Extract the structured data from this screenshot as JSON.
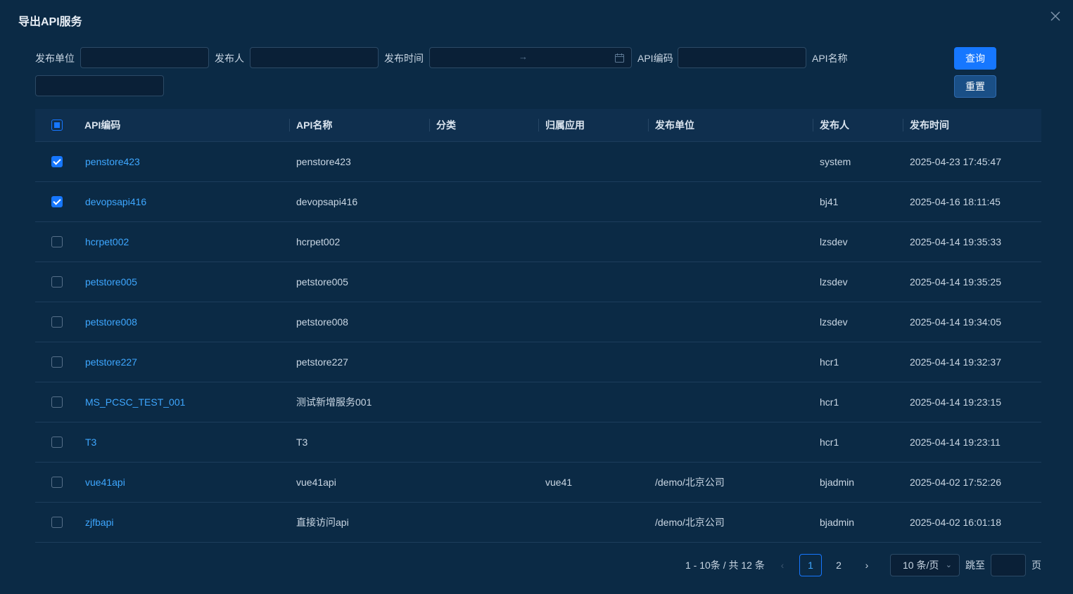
{
  "dialog": {
    "title": "导出API服务"
  },
  "filters": {
    "publish_unit_label": "发布单位",
    "publisher_label": "发布人",
    "publish_time_label": "发布时间",
    "date_separator": "→",
    "api_code_label": "API编码",
    "api_name_label": "API名称",
    "publish_unit_value": "",
    "publisher_value": "",
    "api_code_value": "",
    "api_name_value": "",
    "query_button": "查询",
    "reset_button": "重置"
  },
  "table": {
    "columns": [
      "API编码",
      "API名称",
      "分类",
      "归属应用",
      "发布单位",
      "发布人",
      "发布时间"
    ],
    "rows": [
      {
        "checked": true,
        "code": "penstore423",
        "name": "penstore423",
        "category": "",
        "app": "",
        "unit": "",
        "publisher": "system",
        "time": "2025-04-23 17:45:47"
      },
      {
        "checked": true,
        "code": "devopsapi416",
        "name": "devopsapi416",
        "category": "",
        "app": "",
        "unit": "",
        "publisher": "bj41",
        "time": "2025-04-16 18:11:45"
      },
      {
        "checked": false,
        "code": "hcrpet002",
        "name": "hcrpet002",
        "category": "",
        "app": "",
        "unit": "",
        "publisher": "lzsdev",
        "time": "2025-04-14 19:35:33"
      },
      {
        "checked": false,
        "code": "petstore005",
        "name": "petstore005",
        "category": "",
        "app": "",
        "unit": "",
        "publisher": "lzsdev",
        "time": "2025-04-14 19:35:25"
      },
      {
        "checked": false,
        "code": "petstore008",
        "name": "petstore008",
        "category": "",
        "app": "",
        "unit": "",
        "publisher": "lzsdev",
        "time": "2025-04-14 19:34:05"
      },
      {
        "checked": false,
        "code": "petstore227",
        "name": "petstore227",
        "category": "",
        "app": "",
        "unit": "",
        "publisher": "hcr1",
        "time": "2025-04-14 19:32:37"
      },
      {
        "checked": false,
        "code": "MS_PCSC_TEST_001",
        "name": "测试新增服务001",
        "category": "",
        "app": "",
        "unit": "",
        "publisher": "hcr1",
        "time": "2025-04-14 19:23:15"
      },
      {
        "checked": false,
        "code": "T3",
        "name": "T3",
        "category": "",
        "app": "",
        "unit": "",
        "publisher": "hcr1",
        "time": "2025-04-14 19:23:11"
      },
      {
        "checked": false,
        "code": "vue41api",
        "name": "vue41api",
        "category": "",
        "app": "vue41",
        "unit": "/demo/北京公司",
        "publisher": "bjadmin",
        "time": "2025-04-02 17:52:26"
      },
      {
        "checked": false,
        "code": "zjfbapi",
        "name": "直接访问api",
        "category": "",
        "app": "",
        "unit": "/demo/北京公司",
        "publisher": "bjadmin",
        "time": "2025-04-02 16:01:18"
      }
    ]
  },
  "pagination": {
    "total_text": "1 - 10条 / 共 12 条",
    "pages": [
      "1",
      "2"
    ],
    "current_page": "1",
    "page_size": "10 条/页",
    "jump_label": "跳至",
    "page_label": "页",
    "jump_value": ""
  },
  "colors": {
    "background": "#0b2a45",
    "accent": "#1677ff",
    "link": "#3ea7ff"
  },
  "icons": [
    "close-icon",
    "calendar-icon",
    "chevron-left-icon",
    "chevron-right-icon",
    "chevron-down-icon"
  ]
}
